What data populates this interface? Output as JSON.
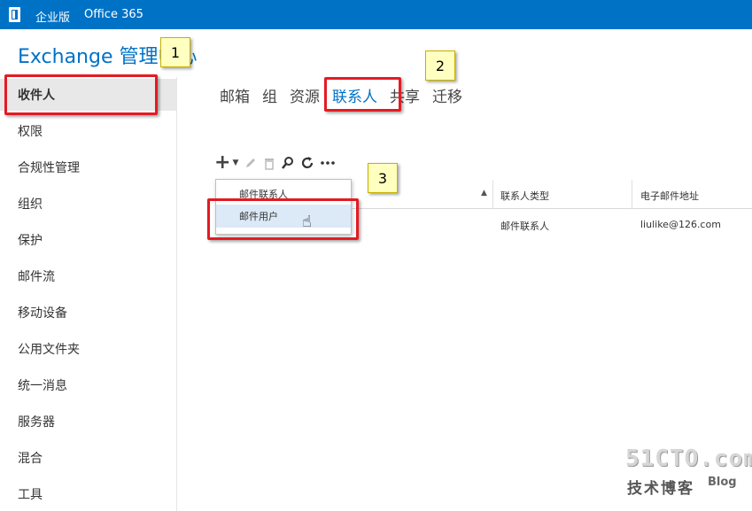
{
  "topbar": {
    "edition": "企业版",
    "office365": "Office 365"
  },
  "app": {
    "title": "Exchange 管理中心"
  },
  "sidebar": {
    "items": [
      {
        "label": "收件人",
        "selected": true
      },
      {
        "label": "权限"
      },
      {
        "label": "合规性管理"
      },
      {
        "label": "组织"
      },
      {
        "label": "保护"
      },
      {
        "label": "邮件流"
      },
      {
        "label": "移动设备"
      },
      {
        "label": "公用文件夹"
      },
      {
        "label": "统一消息"
      },
      {
        "label": "服务器"
      },
      {
        "label": "混合"
      },
      {
        "label": "工具"
      }
    ]
  },
  "tabs": [
    {
      "label": "邮箱"
    },
    {
      "label": "组"
    },
    {
      "label": "资源"
    },
    {
      "label": "联系人",
      "active": true
    },
    {
      "label": "共享"
    },
    {
      "label": "迁移"
    }
  ],
  "toolbar": {
    "icons": [
      "add-icon",
      "edit-icon",
      "delete-icon",
      "search-icon",
      "refresh-icon",
      "more-icon"
    ]
  },
  "grid": {
    "columns": [
      "联系人类型",
      "电子邮件地址"
    ],
    "rows": [
      {
        "type": "邮件联系人",
        "email": "liulike@126.com"
      }
    ]
  },
  "new_menu": {
    "items": [
      "邮件联系人",
      "邮件用户"
    ],
    "hovered": "邮件用户"
  },
  "callouts": [
    "1",
    "2",
    "3"
  ],
  "colors": {
    "brand": "#0072c6",
    "highlight_box": "#e31b23",
    "callout_fill": "#ffffc0"
  }
}
